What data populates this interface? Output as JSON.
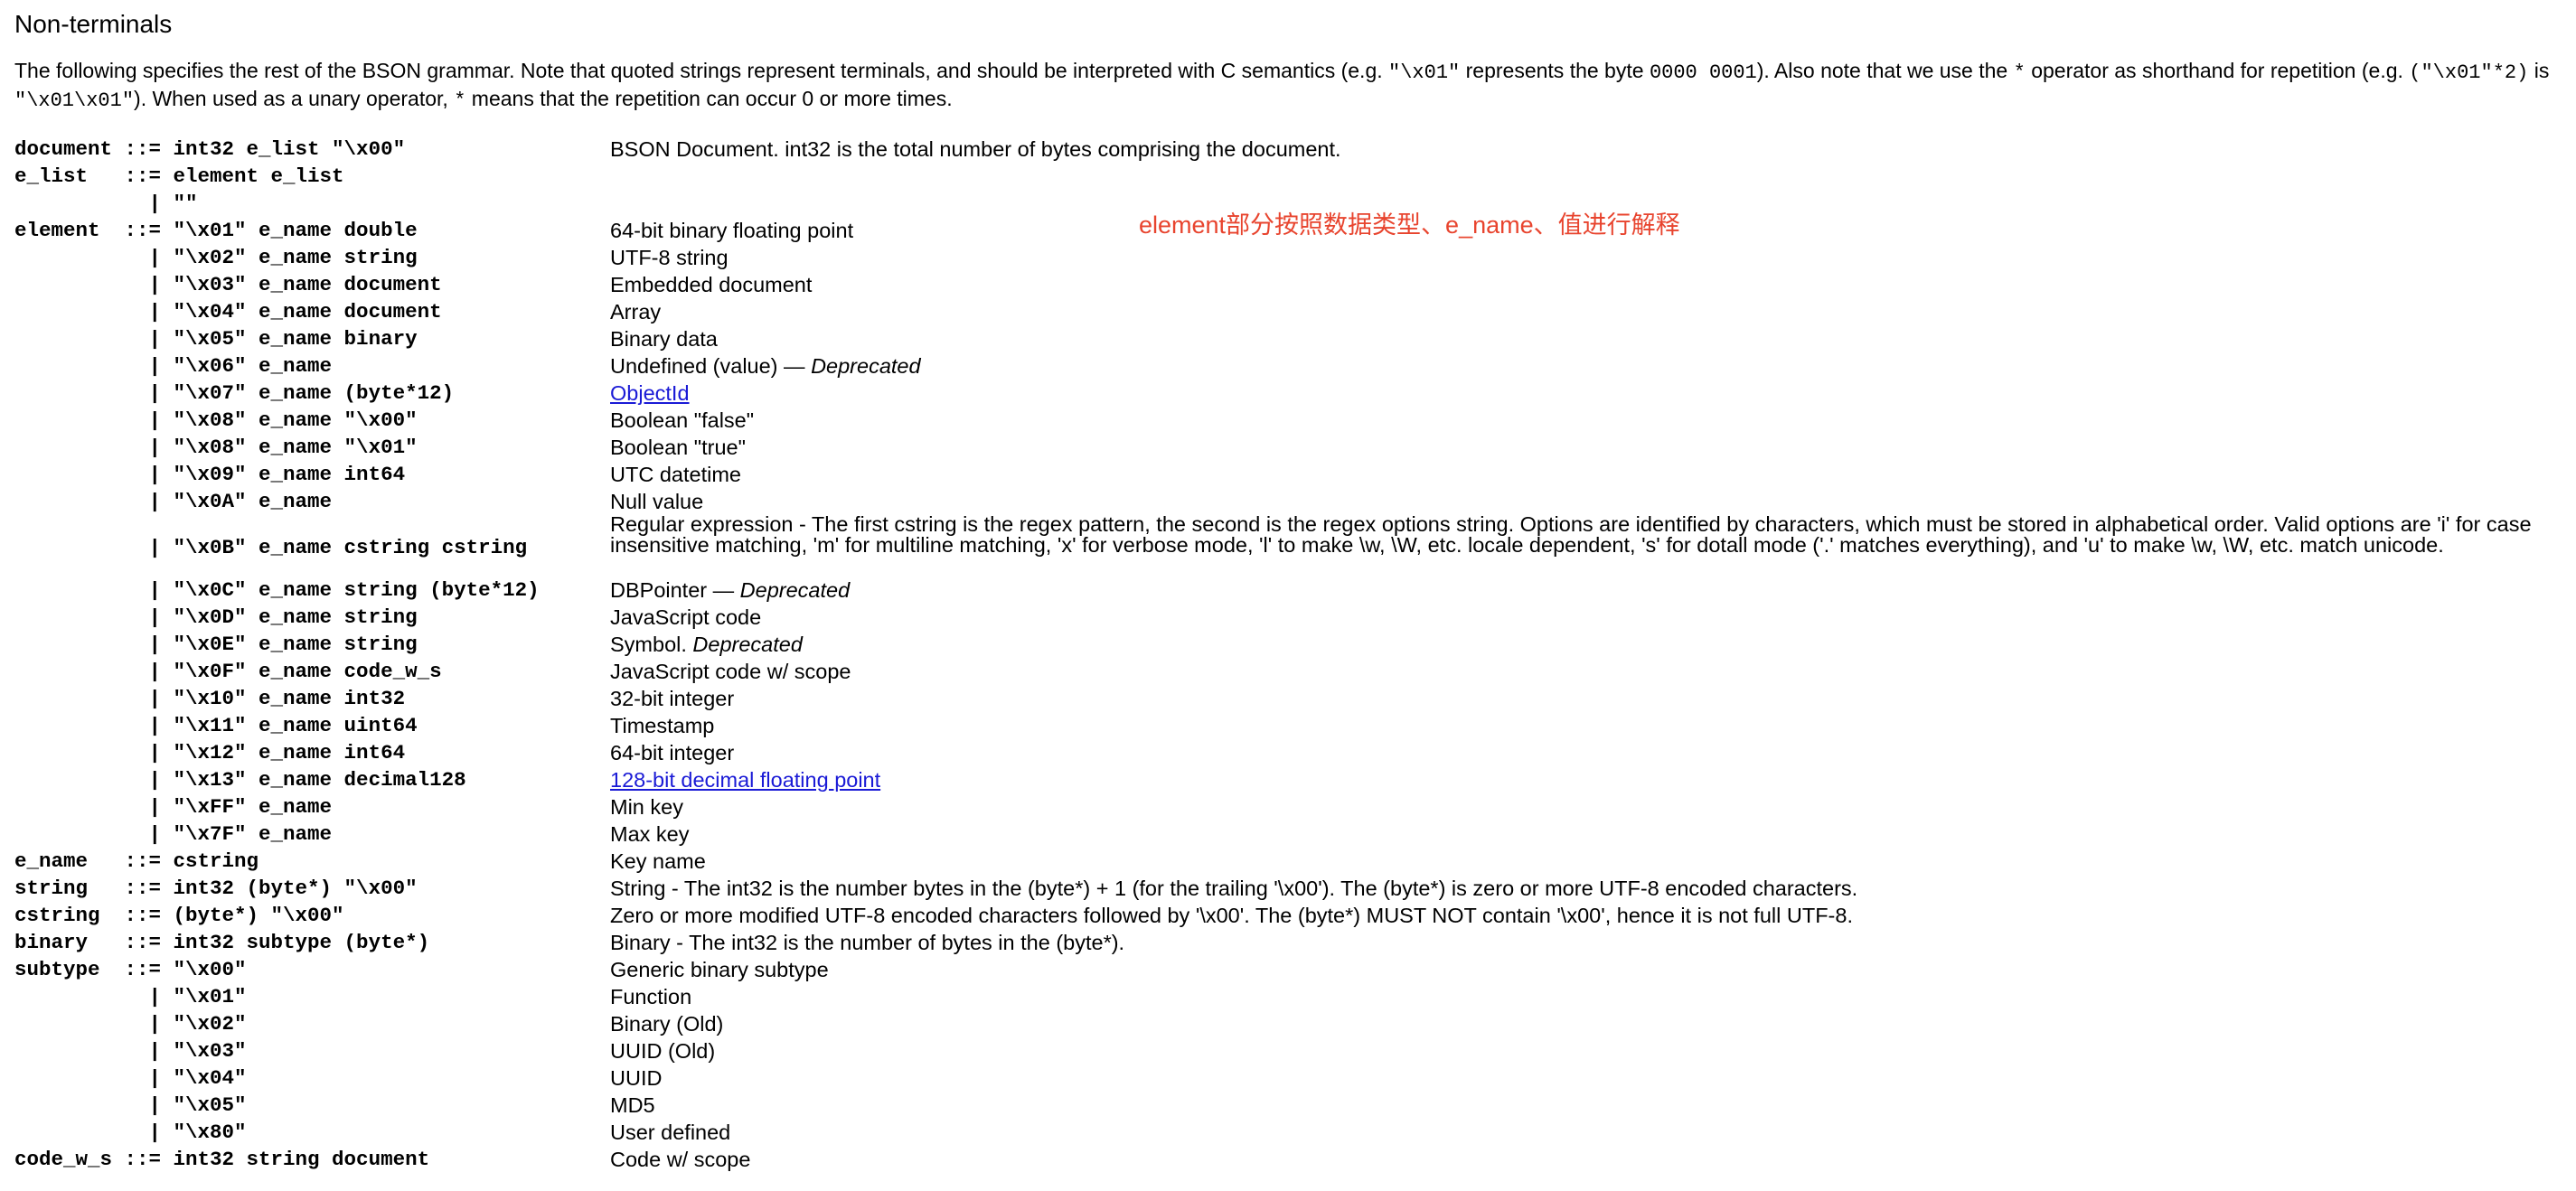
{
  "heading": "Non-terminals",
  "intro": {
    "t1": "The following specifies the rest of the BSON grammar. Note that quoted strings represent terminals, and should be interpreted with C semantics (e.g. ",
    "c1": "\"\\x01\"",
    "t2": " represents the byte ",
    "c2": "0000 0001",
    "t3": "). Also note that we use the ",
    "c3": "*",
    "t4": " operator as shorthand for repetition (e.g. ",
    "c4": "(\"\\x01\"*2)",
    "t5": " is ",
    "c5": "\"\\x01\\x01\"",
    "t6": "). When used as a unary operator, ",
    "c6": "*",
    "t7": " means that the repetition can occur 0 or more times."
  },
  "annotation": "element部分按照数据类型、e_name、值进行解释",
  "grammar": [
    {
      "code": "document ::= int32 e_list \"\\x00\"",
      "desc": "BSON Document. int32 is the total number of bytes comprising the document."
    },
    {
      "code": "e_list   ::= element e_list",
      "desc": ""
    },
    {
      "code": "           | \"\"",
      "desc": ""
    },
    {
      "code": "element  ::= \"\\x01\" e_name double",
      "desc": "64-bit binary floating point"
    },
    {
      "code": "           | \"\\x02\" e_name string",
      "desc": "UTF-8 string"
    },
    {
      "code": "           | \"\\x03\" e_name document",
      "desc": "Embedded document"
    },
    {
      "code": "           | \"\\x04\" e_name document",
      "desc": "Array"
    },
    {
      "code": "           | \"\\x05\" e_name binary",
      "desc": "Binary data"
    },
    {
      "code": "           | \"\\x06\" e_name",
      "desc": "Undefined (value) — ",
      "em": "Deprecated"
    },
    {
      "code": "           | \"\\x07\" e_name (byte*12)",
      "link": "ObjectId"
    },
    {
      "code": "           | \"\\x08\" e_name \"\\x00\"",
      "desc": "Boolean \"false\""
    },
    {
      "code": "           | \"\\x08\" e_name \"\\x01\"",
      "desc": "Boolean \"true\""
    },
    {
      "code": "           | \"\\x09\" e_name int64",
      "desc": "UTC datetime"
    },
    {
      "code": "           | \"\\x0A\" e_name",
      "desc": "Null value"
    },
    {
      "code": "           | \"\\x0B\" e_name cstring cstring",
      "desc": "Regular expression - The first cstring is the regex pattern, the second is the regex options string. Options are identified by characters, which must be stored in alphabetical order. Valid options are 'i' for case insensitive matching, 'm' for multiline matching, 'x' for verbose mode, 'l' to make \\w, \\W, etc. locale dependent, 's' for dotall mode ('.' matches everything), and 'u' to make \\w, \\W, etc. match unicode.",
      "tall": true
    },
    {
      "code": "           | \"\\x0C\" e_name string (byte*12)",
      "desc": "DBPointer — ",
      "em": "Deprecated"
    },
    {
      "code": "           | \"\\x0D\" e_name string",
      "desc": "JavaScript code"
    },
    {
      "code": "           | \"\\x0E\" e_name string",
      "desc": "Symbol. ",
      "em": "Deprecated"
    },
    {
      "code": "           | \"\\x0F\" e_name code_w_s",
      "desc": "JavaScript code w/ scope"
    },
    {
      "code": "           | \"\\x10\" e_name int32",
      "desc": "32-bit integer"
    },
    {
      "code": "           | \"\\x11\" e_name uint64",
      "desc": "Timestamp"
    },
    {
      "code": "           | \"\\x12\" e_name int64",
      "desc": "64-bit integer"
    },
    {
      "code": "           | \"\\x13\" e_name decimal128",
      "link": "128-bit decimal floating point"
    },
    {
      "code": "           | \"\\xFF\" e_name",
      "desc": "Min key"
    },
    {
      "code": "           | \"\\x7F\" e_name",
      "desc": "Max key"
    },
    {
      "code": "e_name   ::= cstring",
      "desc": "Key name"
    },
    {
      "code": "string   ::= int32 (byte*) \"\\x00\"",
      "desc": "String - The int32 is the number bytes in the (byte*) + 1 (for the trailing '\\x00'). The (byte*) is zero or more UTF-8 encoded characters."
    },
    {
      "code": "cstring  ::= (byte*) \"\\x00\"",
      "desc": "Zero or more modified UTF-8 encoded characters followed by '\\x00'. The (byte*) MUST NOT contain '\\x00', hence it is not full UTF-8."
    },
    {
      "code": "binary   ::= int32 subtype (byte*)",
      "desc": "Binary - The int32 is the number of bytes in the (byte*)."
    },
    {
      "code": "subtype  ::= \"\\x00\"",
      "desc": "Generic binary subtype"
    },
    {
      "code": "           | \"\\x01\"",
      "desc": "Function"
    },
    {
      "code": "           | \"\\x02\"",
      "desc": "Binary (Old)"
    },
    {
      "code": "           | \"\\x03\"",
      "desc": "UUID (Old)"
    },
    {
      "code": "           | \"\\x04\"",
      "desc": "UUID"
    },
    {
      "code": "           | \"\\x05\"",
      "desc": "MD5"
    },
    {
      "code": "           | \"\\x80\"",
      "desc": "User defined"
    },
    {
      "code": "code_w_s ::= int32 string document",
      "desc": "Code w/ scope"
    }
  ]
}
